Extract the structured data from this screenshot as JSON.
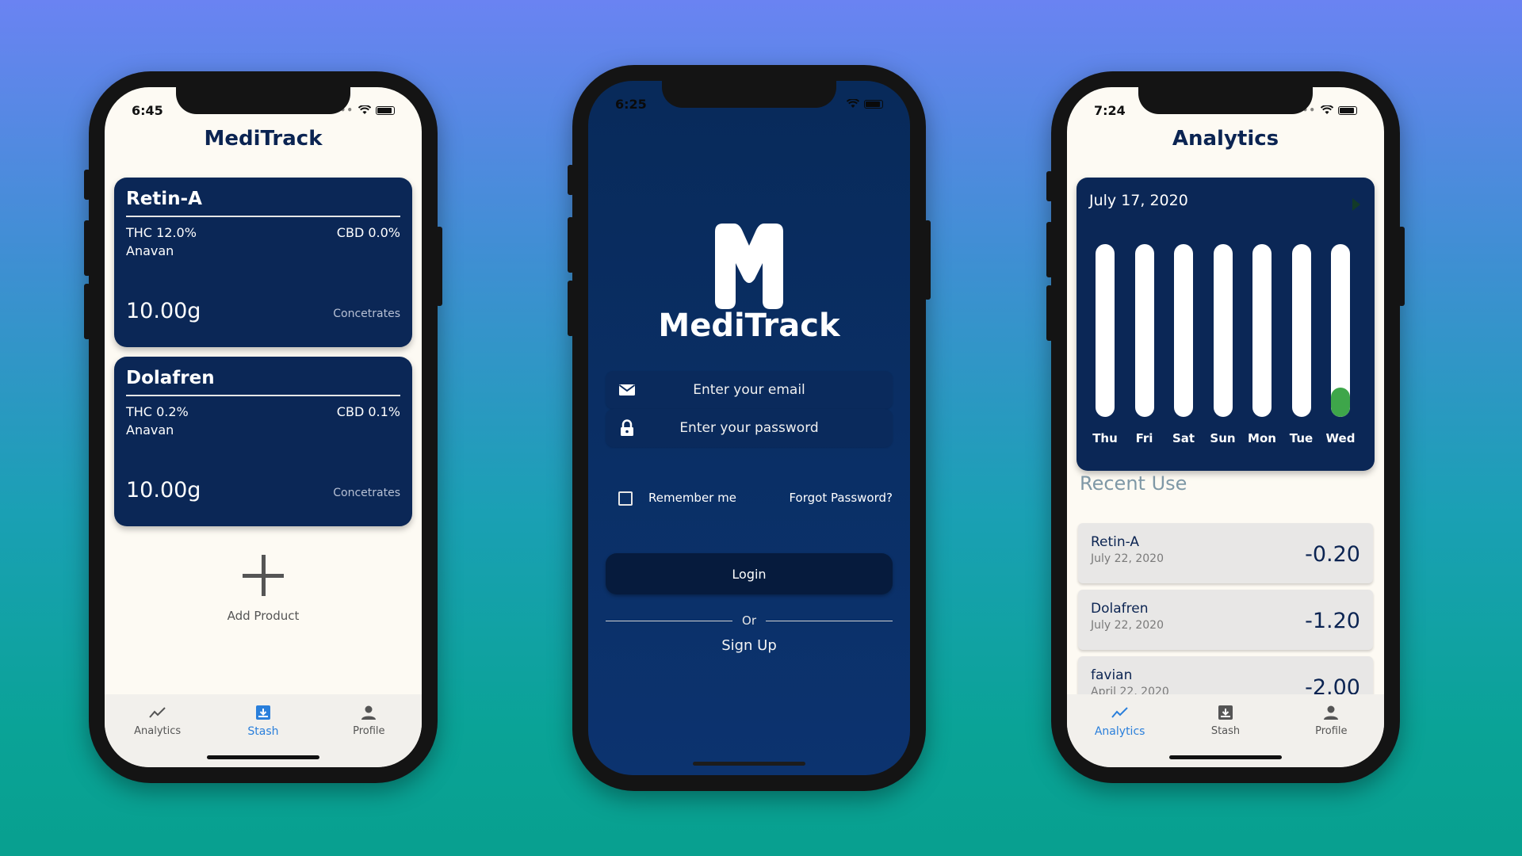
{
  "phone_stash": {
    "status_time": "6:45",
    "title": "MediTrack",
    "products": [
      {
        "name": "Retin-A",
        "thc": "THC 12.0%",
        "cbd": "CBD 0.0%",
        "brand": "Anavan",
        "amount": "10.00g",
        "category": "Concetrates"
      },
      {
        "name": "Dolafren",
        "thc": "THC 0.2%",
        "cbd": "CBD 0.1%",
        "brand": "Anavan",
        "amount": "10.00g",
        "category": "Concetrates"
      }
    ],
    "add_product_label": "Add Product",
    "tabs": [
      {
        "label": "Analytics",
        "icon": "chart-line-icon",
        "active": false
      },
      {
        "label": "Stash",
        "icon": "stash-box-icon",
        "active": true
      },
      {
        "label": "Profile",
        "icon": "person-icon",
        "active": false
      }
    ]
  },
  "phone_login": {
    "status_time": "6:25",
    "logo_letter": "M",
    "app_name": "MediTrack",
    "email_placeholder": "Enter your email",
    "password_placeholder": "Enter your password",
    "remember_label": "Remember me",
    "forgot_label": "Forgot Password?",
    "login_label": "Login",
    "or_label": "Or",
    "signup_label": "Sign Up"
  },
  "phone_analytics": {
    "status_time": "7:24",
    "title": "Analytics",
    "chart_date": "July 17, 2020",
    "recent_title": "Recent Use",
    "recent": [
      {
        "name": "Retin-A",
        "date": "July 22, 2020",
        "amount": "-0.20"
      },
      {
        "name": "Dolafren",
        "date": "July 22, 2020",
        "amount": "-1.20"
      },
      {
        "name": "favian",
        "date": "April 22, 2020",
        "amount": "-2.00"
      }
    ],
    "tabs": [
      {
        "label": "Analytics",
        "icon": "chart-line-icon",
        "active": true
      },
      {
        "label": "Stash",
        "icon": "stash-box-icon",
        "active": false
      },
      {
        "label": "Profile",
        "icon": "person-icon",
        "active": false
      }
    ]
  },
  "colors": {
    "navy": "#0b2756",
    "accent_blue": "#2a7fdb",
    "bar_green": "#3ea64a",
    "cream": "#fdfaf3"
  },
  "chart_data": {
    "type": "bar",
    "categories": [
      "Thu",
      "Fri",
      "Sat",
      "Sun",
      "Mon",
      "Tue",
      "Wed"
    ],
    "values": [
      0,
      0,
      0,
      0,
      0,
      0,
      0.17
    ],
    "ylim": [
      0,
      1
    ]
  }
}
